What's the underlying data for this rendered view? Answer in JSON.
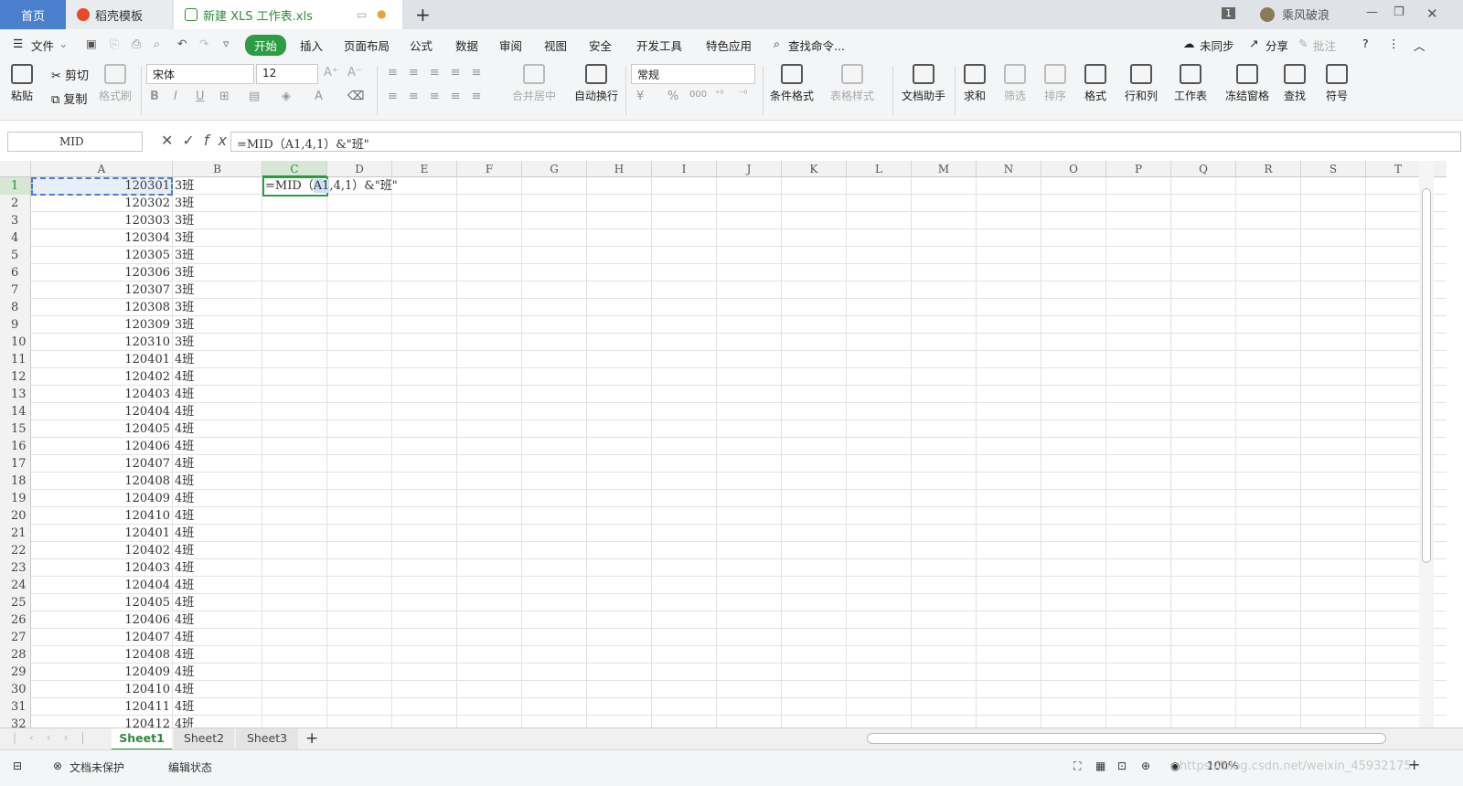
{
  "titlebar": {
    "home": "首页",
    "template": "稻壳模板",
    "file": "新建 XLS 工作表.xls",
    "badge": "1",
    "user": "乘风破浪"
  },
  "menu": {
    "file": "文件",
    "items": [
      "开始",
      "插入",
      "页面布局",
      "公式",
      "数据",
      "审阅",
      "视图",
      "安全",
      "开发工具",
      "特色应用"
    ],
    "search": "查找命令...",
    "sync": "未同步",
    "share": "分享",
    "comment": "批注"
  },
  "ribbon": {
    "paste": "粘贴",
    "cut": "剪切",
    "copy": "复制",
    "format_painter": "格式刷",
    "font": "宋体",
    "size": "12",
    "merge": "合并居中",
    "wrap": "自动换行",
    "numfmt": "常规",
    "cond_format": "条件格式",
    "table_style": "表格样式",
    "doc_helper": "文档助手",
    "sum": "求和",
    "filter": "筛选",
    "sort": "排序",
    "format": "格式",
    "rowcol": "行和列",
    "worksheet": "工作表",
    "freeze": "冻结窗格",
    "find": "查找",
    "symbol": "符号",
    "percent": "%",
    "thousands": "000"
  },
  "formula_bar": {
    "name_box": "MID",
    "formula": "=MID（A1,4,1）&\"班\""
  },
  "columns": [
    "A",
    "B",
    "C",
    "D",
    "E",
    "F",
    "G",
    "H",
    "I",
    "J",
    "K",
    "L",
    "M",
    "N",
    "O",
    "P",
    "Q",
    "R",
    "S",
    "T"
  ],
  "rows": [
    {
      "n": "1",
      "a": "120301",
      "b": "3班"
    },
    {
      "n": "2",
      "a": "120302",
      "b": "3班"
    },
    {
      "n": "3",
      "a": "120303",
      "b": "3班"
    },
    {
      "n": "4",
      "a": "120304",
      "b": "3班"
    },
    {
      "n": "5",
      "a": "120305",
      "b": "3班"
    },
    {
      "n": "6",
      "a": "120306",
      "b": "3班"
    },
    {
      "n": "7",
      "a": "120307",
      "b": "3班"
    },
    {
      "n": "8",
      "a": "120308",
      "b": "3班"
    },
    {
      "n": "9",
      "a": "120309",
      "b": "3班"
    },
    {
      "n": "10",
      "a": "120310",
      "b": "3班"
    },
    {
      "n": "11",
      "a": "120401",
      "b": "4班"
    },
    {
      "n": "12",
      "a": "120402",
      "b": "4班"
    },
    {
      "n": "13",
      "a": "120403",
      "b": "4班"
    },
    {
      "n": "14",
      "a": "120404",
      "b": "4班"
    },
    {
      "n": "15",
      "a": "120405",
      "b": "4班"
    },
    {
      "n": "16",
      "a": "120406",
      "b": "4班"
    },
    {
      "n": "17",
      "a": "120407",
      "b": "4班"
    },
    {
      "n": "18",
      "a": "120408",
      "b": "4班"
    },
    {
      "n": "19",
      "a": "120409",
      "b": "4班"
    },
    {
      "n": "20",
      "a": "120410",
      "b": "4班"
    },
    {
      "n": "21",
      "a": "120401",
      "b": "4班"
    },
    {
      "n": "22",
      "a": "120402",
      "b": "4班"
    },
    {
      "n": "23",
      "a": "120403",
      "b": "4班"
    },
    {
      "n": "24",
      "a": "120404",
      "b": "4班"
    },
    {
      "n": "25",
      "a": "120405",
      "b": "4班"
    },
    {
      "n": "26",
      "a": "120406",
      "b": "4班"
    },
    {
      "n": "27",
      "a": "120407",
      "b": "4班"
    },
    {
      "n": "28",
      "a": "120408",
      "b": "4班"
    },
    {
      "n": "29",
      "a": "120409",
      "b": "4班"
    },
    {
      "n": "30",
      "a": "120410",
      "b": "4班"
    },
    {
      "n": "31",
      "a": "120411",
      "b": "4班"
    },
    {
      "n": "32",
      "a": "120412",
      "b": "4班"
    }
  ],
  "c1_text": {
    "pre": "=MID（",
    "ref": "A1",
    "post": ",4,1）&\"班\""
  },
  "sheets": [
    "Sheet1",
    "Sheet2",
    "Sheet3"
  ],
  "status": {
    "protect": "文档未保护",
    "mode": "编辑状态",
    "zoom": "100%",
    "watermark": "https://blog.csdn.net/weixin_45932175"
  }
}
